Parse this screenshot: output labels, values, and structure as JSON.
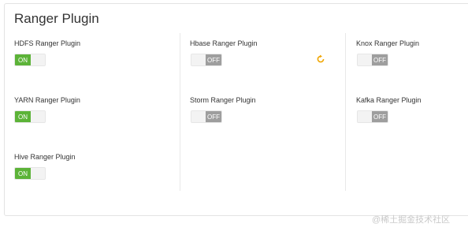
{
  "panel": {
    "title": "Ranger Plugin"
  },
  "plugins": [
    {
      "label": "HDFS Ranger Plugin",
      "state": "ON"
    },
    {
      "label": "YARN Ranger Plugin",
      "state": "ON"
    },
    {
      "label": "Hive Ranger Plugin",
      "state": "ON"
    },
    {
      "label": "Hbase Ranger Plugin",
      "state": "OFF"
    },
    {
      "label": "Storm Ranger Plugin",
      "state": "OFF"
    },
    {
      "label": "Knox Ranger Plugin",
      "state": "OFF"
    },
    {
      "label": "Kafka Ranger Plugin",
      "state": "OFF"
    }
  ],
  "colors": {
    "on": "#5cb338",
    "off": "#9e9e9e",
    "refresh": "#f0a500"
  },
  "icons": {
    "refresh": "refresh-icon"
  },
  "watermark": "@稀土掘金技术社区"
}
